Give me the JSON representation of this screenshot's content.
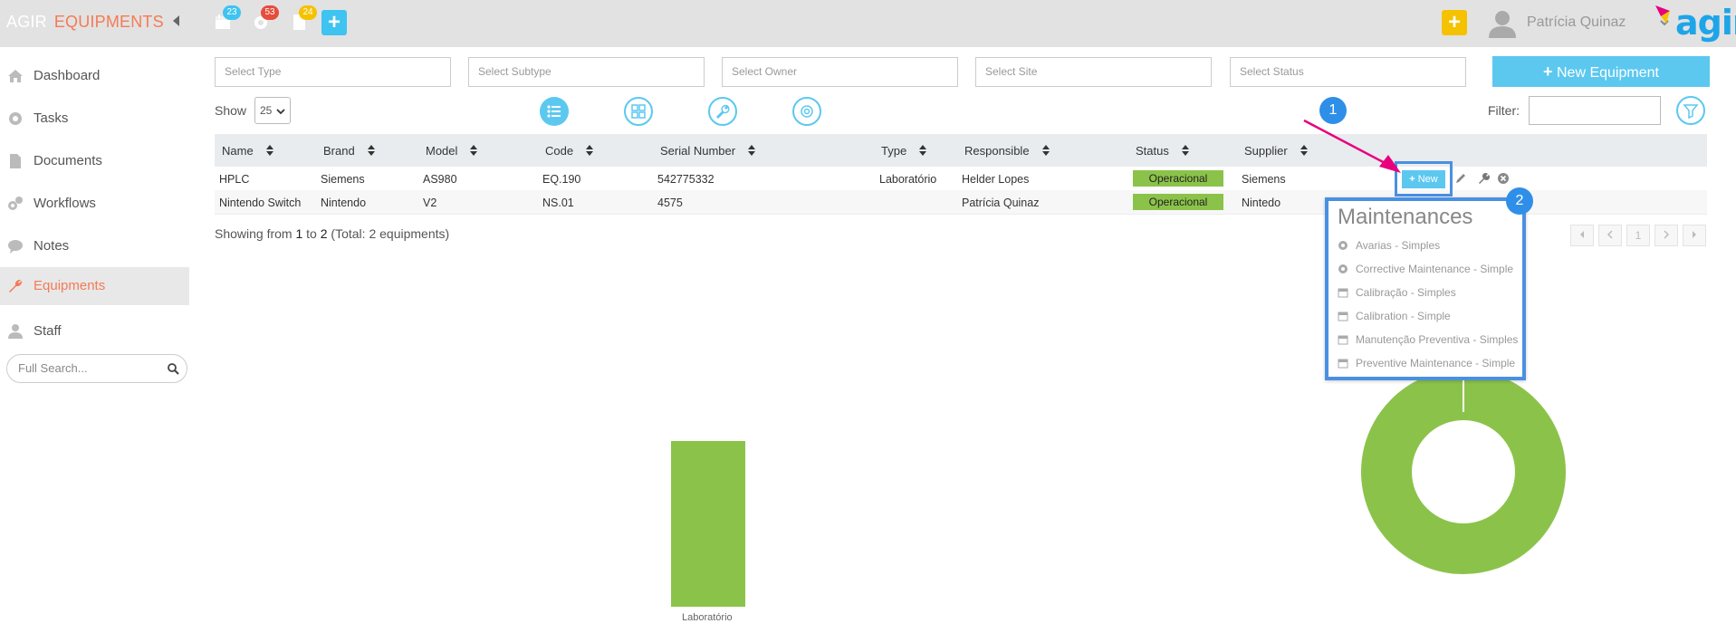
{
  "header": {
    "brand": "AGIR",
    "module": "EQUIPMENTS",
    "badges": [
      {
        "icon": "calendar-icon",
        "count": "23",
        "color": "#3fc3f0"
      },
      {
        "icon": "gear-icon",
        "count": "53",
        "color": "#e74c3c"
      },
      {
        "icon": "document-icon",
        "count": "24",
        "color": "#f5c200"
      }
    ],
    "user_name": "Patrícia Quinaz",
    "logo_text": "agir"
  },
  "sidebar": {
    "items": [
      {
        "label": "Dashboard",
        "icon": "home-icon"
      },
      {
        "label": "Tasks",
        "icon": "gear-icon"
      },
      {
        "label": "Documents",
        "icon": "document-icon"
      },
      {
        "label": "Workflows",
        "icon": "gears-icon"
      },
      {
        "label": "Notes",
        "icon": "chat-icon"
      },
      {
        "label": "Equipments",
        "icon": "wrench-icon",
        "active": true
      },
      {
        "label": "Staff",
        "icon": "user-icon"
      }
    ],
    "search_placeholder": "Full Search..."
  },
  "filters": {
    "type": "Select Type",
    "subtype": "Select Subtype",
    "owner": "Select Owner",
    "site": "Select Site",
    "status": "Select Status"
  },
  "new_equipment_label": "New Equipment",
  "show_label": "Show",
  "show_value": "25",
  "filter_label": "Filter:",
  "table": {
    "columns": [
      "Name",
      "Brand",
      "Model",
      "Code",
      "Serial Number",
      "Type",
      "Responsible",
      "Status",
      "Supplier"
    ],
    "rows": [
      {
        "name": "HPLC",
        "brand": "Siemens",
        "model": "AS980",
        "code": "EQ.190",
        "serial": "542775332",
        "type": "Laboratório",
        "responsible": "Helder Lopes",
        "status": "Operacional",
        "supplier": "Siemens"
      },
      {
        "name": "Nintendo Switch",
        "brand": "Nintendo",
        "model": "V2",
        "code": "NS.01",
        "serial": "4575",
        "type": "",
        "responsible": "Patrícia Quinaz",
        "status": "Operacional",
        "supplier": "Nintedo"
      }
    ],
    "new_button_label": "New"
  },
  "showing": {
    "prefix": "Showing from ",
    "from": "1",
    "mid": " to ",
    "to": "2",
    "suffix": " (Total: 2 equipments)"
  },
  "pagination": {
    "current": "1"
  },
  "maintenances": {
    "title": "Maintenances",
    "items": [
      {
        "label": "Avarias - Simples",
        "icon": "gear-icon"
      },
      {
        "label": "Corrective Maintenance - Simple",
        "icon": "gear-icon"
      },
      {
        "label": "Calibração - Simples",
        "icon": "calendar-icon"
      },
      {
        "label": "Calibration - Simple",
        "icon": "calendar-icon"
      },
      {
        "label": "Manutenção Preventiva - Simples",
        "icon": "calendar-icon"
      },
      {
        "label": "Preventive Maintenance - Simple",
        "icon": "calendar-icon"
      }
    ]
  },
  "markers": [
    "1",
    "2"
  ],
  "charts": {
    "bar": {
      "category": "Laboratório",
      "color": "#8bc34a"
    },
    "donut": {
      "color": "#8bc34a"
    }
  }
}
